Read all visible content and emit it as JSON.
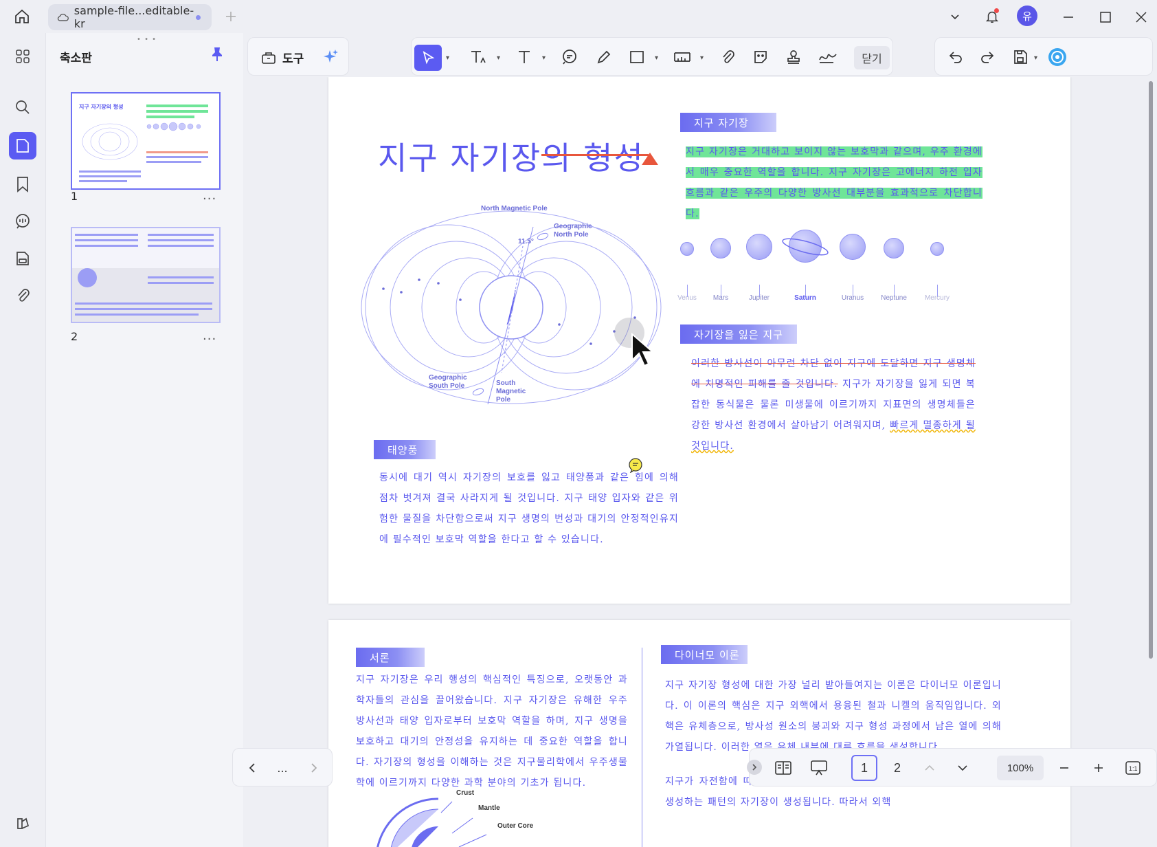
{
  "tab": {
    "title": "sample-file...editable-kr"
  },
  "user": {
    "avatar_initial": "유"
  },
  "panel": {
    "title": "축소판",
    "thumbs": [
      {
        "num": "1",
        "more": "..."
      },
      {
        "num": "2",
        "more": "..."
      }
    ]
  },
  "toolbar": {
    "tools_label": "도구",
    "close_label": "닫기"
  },
  "page1": {
    "title": "지구 자기장의 형성",
    "sec_magnetic": "지구 자기장",
    "sec_magnetic_text": "지구 자기장은 거대하고 보이지 않는 보호막과 같으며, 우주 환경에서 매우 중요한 역할을 합니다. 지구 자기장은 고에너지 하전 입자흐름과 같은 우주의 다양한 방사선 대부분을 효과적으로 차단합니다.",
    "sec_lost": "자기장을 잃은 지구",
    "lost_strike": "이러한 방사선이 아무런 차단 없이 지구에 도달하면 지구 생명체에 치명적인 피해를 줄 것입니다.",
    "lost_plain": " 지구가 자기장을 잃게 되면 복잡한 동식물은 물론 미생물에 이르기까지 지표면의 생명체들은 강한 방사선 환경에서 살아남기 어려워지며, ",
    "lost_wavy": "빠르게 멸종하게 될 것입니다.",
    "sec_solar": "태양풍",
    "solar_text": "동시에 대기 역시 자기장의 보호를 잃고 태양풍과 같은 힘에 의해 점차 벗겨져 결국 사라지게 될 것입니다. 지구 태양 입자와 같은 위험한 물질을 차단함으로써 지구 생명의 번성과 대기의 안정적인유지에 필수적인 보호막 역할을 한다고 할 수 있습니다.",
    "diagram_labels": {
      "north_mag": "North Magnetic Pole",
      "geo_north": "Geographic North Pole",
      "geo_south": "Geographic South Pole",
      "south_mag": "South Magnetic Pole",
      "angle": "11.5°"
    },
    "planets": [
      "Venus",
      "Mars",
      "Jupiter",
      "Saturn",
      "Uranus",
      "Neptune",
      "Mercury"
    ]
  },
  "page2": {
    "sec_intro": "서론",
    "intro_text": "지구 자기장은 우리 행성의 핵심적인 특징으로, 오랫동안 과학자들의 관심을 끌어왔습니다. 지구 자기장은 유해한 우주 방사선과 태양 입자로부터 보호막 역할을 하며, 지구 생명을 보호하고 대기의 안정성을 유지하는 데 중요한 역할을 합니다. 자기장의 형성을 이해하는 것은 지구물리학에서 우주생물학에 이르기까지 다양한 과학 분야의 기초가 됩니다.",
    "sec_dynamo": "다이너모 이론",
    "dynamo_text1": "지구 자기장 형성에 대한 가장 널리 받아들여지는 이론은 다이너모 이론입니다. 이 이론의 핵심은 지구 외핵에서 용융된 철과 니켈의 움직임입니다. 외핵은 유체층으로, 방사성 원소의 붕괴와 지구 형성 과정에서 남은 열에 의해 가열됩니다. 이러한 열은 유체 내부에 대류 흐름을 생성합니다.",
    "dynamo_text2": "지구가 자전함에 따라 코리올리 힘이 이러한 대류 흐름에 작용하여 전류를 생성하는 패턴의 자기장이 생성됩니다. 따라서 외핵",
    "earth_labels": {
      "crust": "Crust",
      "mantle": "Mantle",
      "outer_core": "Outer Core"
    }
  },
  "pager": {
    "nav_more": "...",
    "page1": "1",
    "page2": "2",
    "zoom": "100%"
  }
}
